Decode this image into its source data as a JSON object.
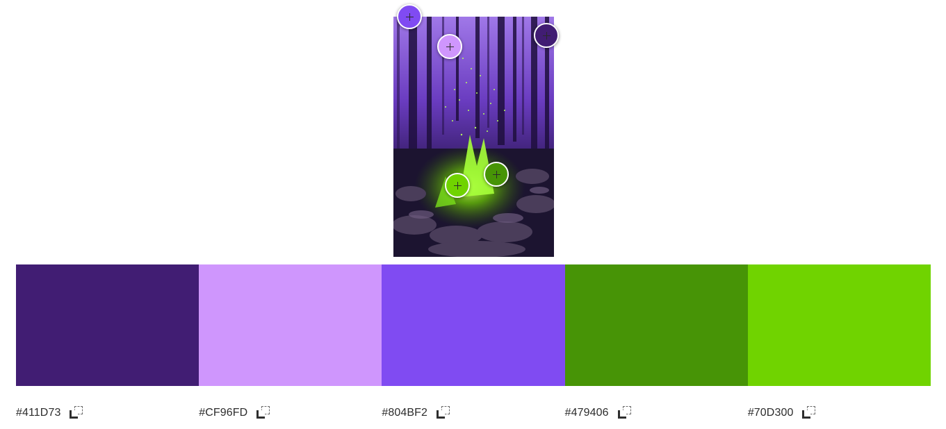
{
  "image": {
    "alt": "purple forest campfire with green flames",
    "icon": "campfire-photo"
  },
  "pickers": [
    {
      "color": "#804BF2"
    },
    {
      "color": "#CF96FD"
    },
    {
      "color": "#411D73"
    },
    {
      "color": "#70D300"
    },
    {
      "color": "#479406"
    }
  ],
  "palette": [
    {
      "hex": "#411D73",
      "color": "#411D73"
    },
    {
      "hex": "#CF96FD",
      "color": "#CF96FD"
    },
    {
      "hex": "#804BF2",
      "color": "#804BF2"
    },
    {
      "hex": "#479406",
      "color": "#479406"
    },
    {
      "hex": "#70D300",
      "color": "#70D300"
    }
  ],
  "icons": {
    "copy": "copy-icon",
    "picker": "crosshair-plus-icon"
  }
}
